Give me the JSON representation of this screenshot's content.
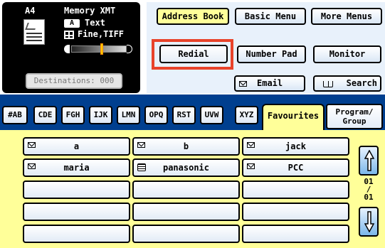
{
  "status": {
    "paper_size": "A4",
    "mode_title": "Memory XMT",
    "text_mode_icon": "A",
    "text_mode": "Text",
    "resolution": "Fine,TIFF",
    "contrast_level": 0.55,
    "destinations": "Destinations: 000"
  },
  "menu": {
    "address_book": "Address Book",
    "basic_menu": "Basic Menu",
    "more_menus": "More Menus"
  },
  "actions": {
    "redial": "Redial",
    "number_pad": "Number Pad",
    "monitor": "Monitor",
    "email": "Email",
    "search": "Search"
  },
  "tabs": {
    "items": [
      "#AB",
      "CDE",
      "FGH",
      "IJK",
      "LMN",
      "OPQ",
      "RST",
      "UVW",
      "XYZ"
    ],
    "favourites": "Favourites",
    "program_group": [
      "Program/",
      "Group"
    ],
    "active": "Favourites"
  },
  "entries": [
    {
      "name": "a",
      "type": "email"
    },
    {
      "name": "b",
      "type": "email"
    },
    {
      "name": "jack",
      "type": "email"
    },
    {
      "name": "maria",
      "type": "email"
    },
    {
      "name": "panasonic",
      "type": "fax"
    },
    {
      "name": "PCC",
      "type": "email"
    },
    {
      "name": "",
      "type": ""
    },
    {
      "name": "",
      "type": ""
    },
    {
      "name": "",
      "type": ""
    },
    {
      "name": "",
      "type": ""
    },
    {
      "name": "",
      "type": ""
    },
    {
      "name": "",
      "type": ""
    },
    {
      "name": "",
      "type": ""
    },
    {
      "name": "",
      "type": ""
    },
    {
      "name": "",
      "type": ""
    }
  ],
  "page": {
    "current": "01",
    "separator": "/",
    "total": "01"
  },
  "colors": {
    "tab_bar": "#003f8f",
    "highlight": "#ffff99",
    "annotation_box": "#e8432a",
    "scroll_button": "#7bb7ea"
  },
  "icons": {
    "email": "envelope-icon",
    "fax": "fax-icon",
    "search": "book-icon",
    "scroll_up": "arrow-up-icon",
    "scroll_down": "arrow-down-icon"
  }
}
